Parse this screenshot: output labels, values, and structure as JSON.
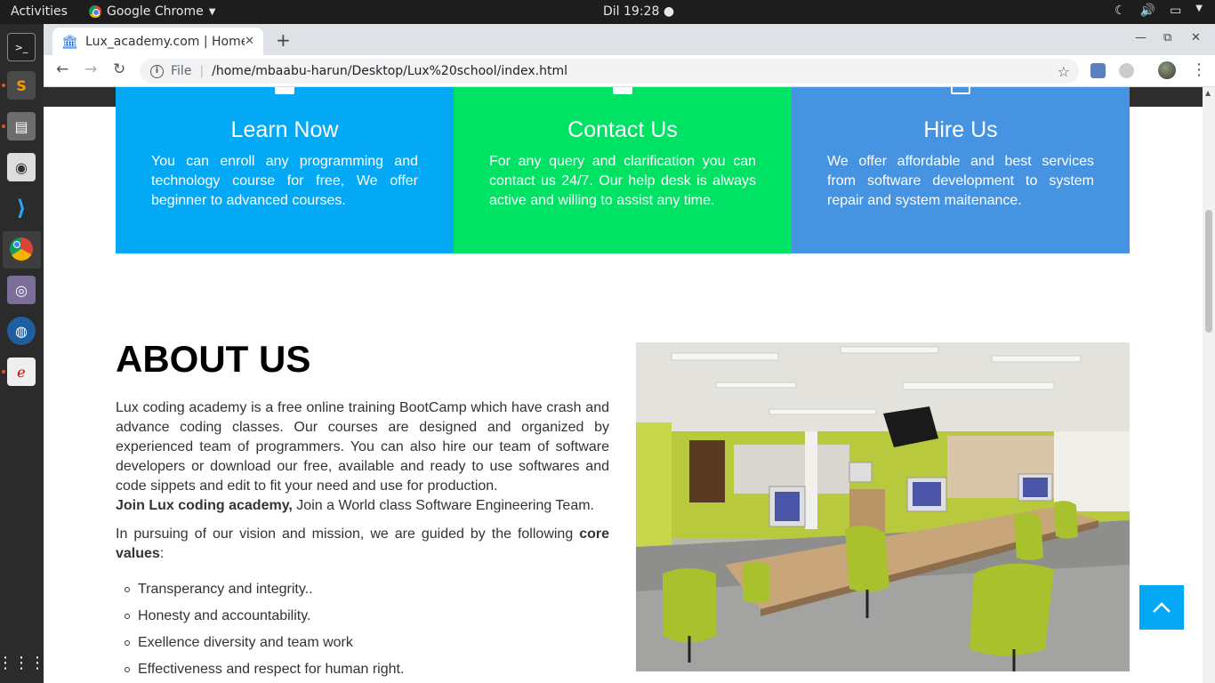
{
  "system_bar": {
    "activities": "Activities",
    "app_name": "Google Chrome",
    "clock": "Dil 19:28"
  },
  "browser": {
    "tab_title": "Lux_academy.com | Home",
    "scheme": "File",
    "url": "/home/mbaabu-harun/Desktop/Lux%20school/index.html"
  },
  "features": [
    {
      "title": "Learn Now",
      "text": "You can enroll any programming and technology course for free, We offer beginner to advanced courses.",
      "color": "#03a9f4"
    },
    {
      "title": "Contact Us",
      "text": "For any query and clarification you can contact us 24/7. Our help desk is always active and willing to assist any time.",
      "color": "#00e264"
    },
    {
      "title": "Hire Us",
      "text": "We offer affordable and best services from software development to system repair and system maitenance.",
      "color": "#4693e1"
    }
  ],
  "about": {
    "heading": "ABOUT US",
    "intro": "Lux coding academy is a free online training BootCamp which have crash and advance coding classes. Our courses are designed and organized by experienced team of programmers. You can also hire our team of software developers or download our free, available and ready to use softwares and code sippets and edit to fit your need and use for production.",
    "join_bold": "Join Lux coding academy,",
    "join_rest": " Join a World class Software Engineering Team.",
    "values_intro": "In pursuing of our vision and mission, we are guided by the following ",
    "values_bold": "core values",
    "values_colon": ":",
    "values": [
      "Transperancy and integrity..",
      "Honesty and accountability.",
      "Exellence diversity and team work",
      "Effectiveness and respect for human right."
    ]
  },
  "accent": "#03a9f4"
}
